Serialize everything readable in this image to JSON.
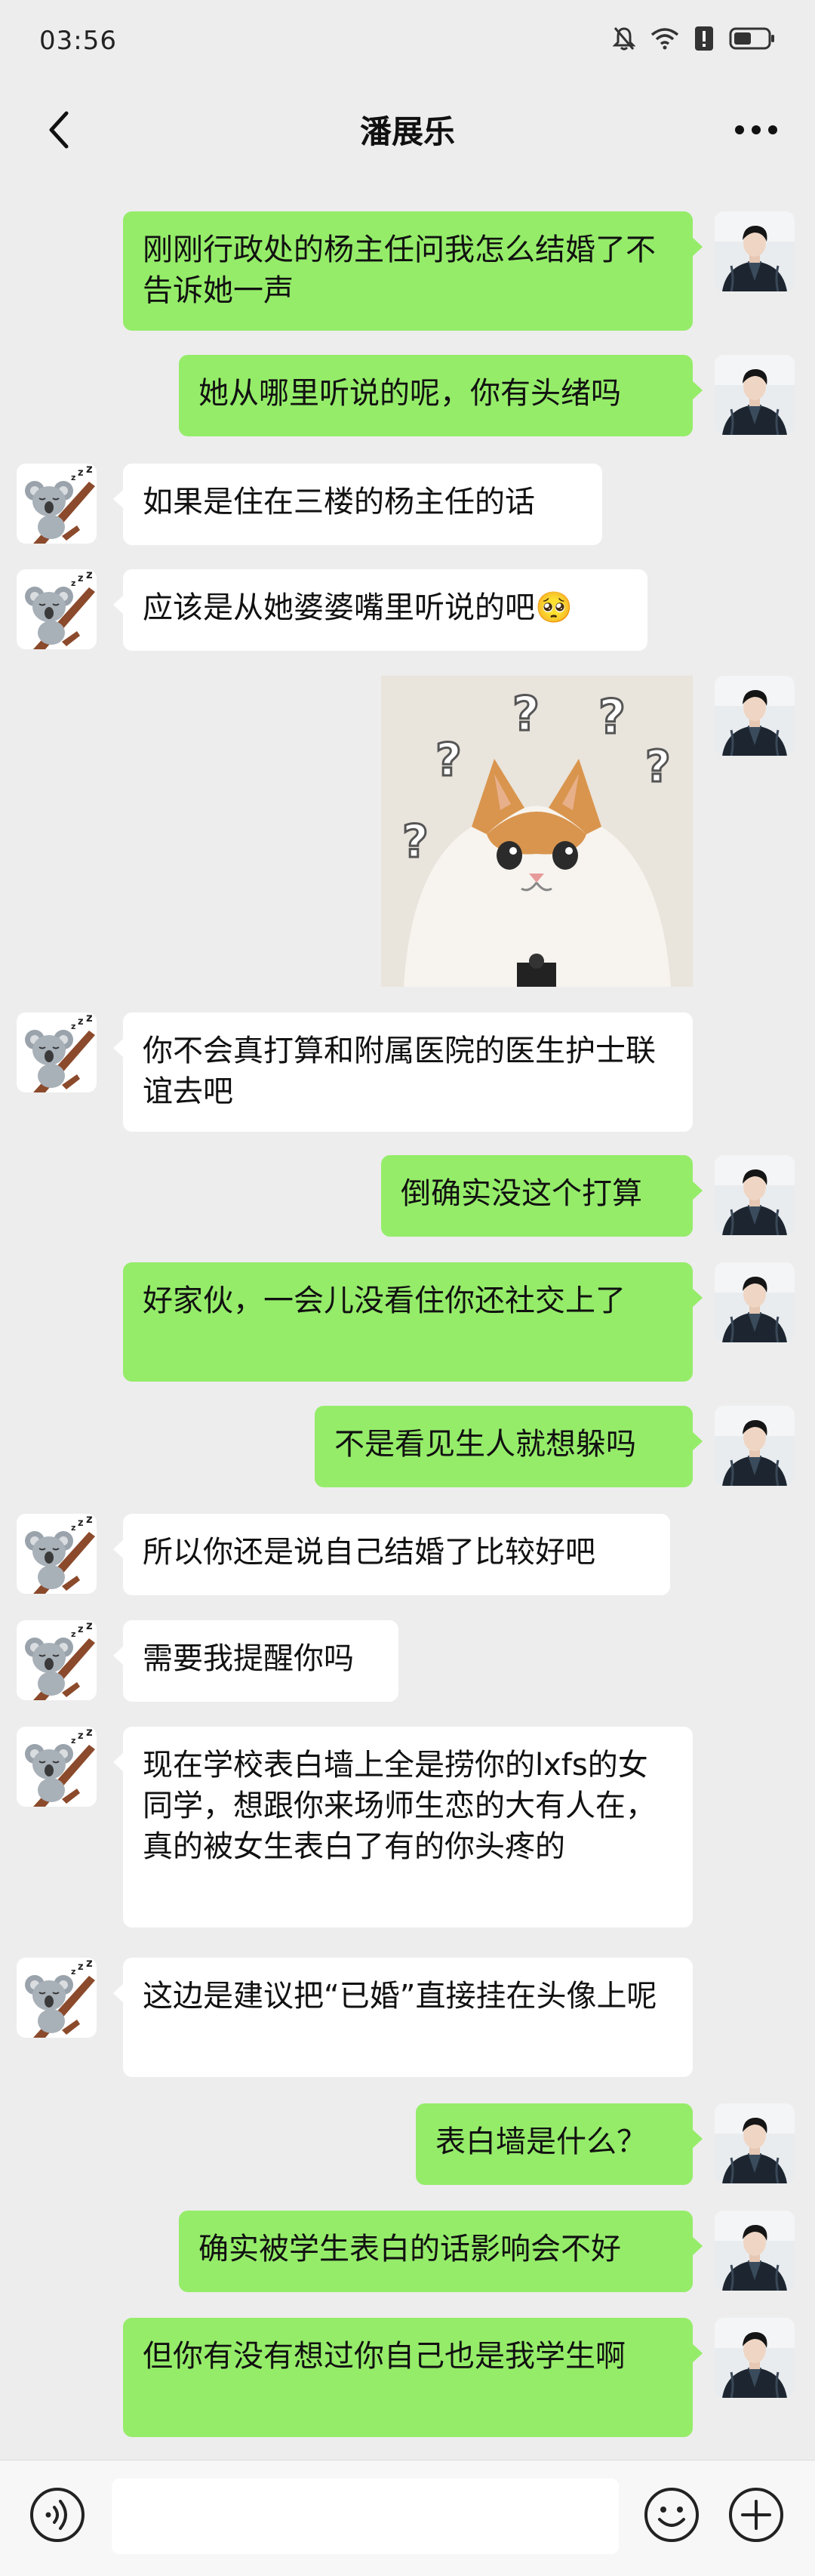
{
  "status_bar": {
    "time": "03:56"
  },
  "nav": {
    "title": "潘展乐"
  },
  "input": {
    "placeholder": ""
  },
  "messages": [
    {
      "side": "me",
      "type": "text",
      "text": "刚刚行政处的杨主任问我怎么结婚了不告诉她一声"
    },
    {
      "side": "me",
      "type": "text",
      "text": "她从哪里听说的呢，你有头绪吗"
    },
    {
      "side": "them",
      "type": "text",
      "text": "如果是住在三楼的杨主任的话"
    },
    {
      "side": "them",
      "type": "text",
      "text": "应该是从她婆婆嘴里听说的吧🥺"
    },
    {
      "side": "me",
      "type": "sticker",
      "sticker": "confused-cat-sticker"
    },
    {
      "side": "them",
      "type": "text",
      "text": "你不会真打算和附属医院的医生护士联谊去吧"
    },
    {
      "side": "me",
      "type": "text",
      "text": "倒确实没这个打算"
    },
    {
      "side": "me",
      "type": "text",
      "text": "好家伙，一会儿没看住你还社交上了"
    },
    {
      "side": "me",
      "type": "text",
      "text": "不是看见生人就想躲吗"
    },
    {
      "side": "them",
      "type": "text",
      "text": "所以你还是说自己结婚了比较好吧"
    },
    {
      "side": "them",
      "type": "text",
      "text": "需要我提醒你吗"
    },
    {
      "side": "them",
      "type": "text",
      "text": "现在学校表白墙上全是捞你的lxfs的女同学，想跟你来场师生恋的大有人在，真的被女生表白了有的你头疼的"
    },
    {
      "side": "them",
      "type": "text",
      "text": "这边是建议把“已婚”直接挂在头像上呢"
    },
    {
      "side": "me",
      "type": "text",
      "text": "表白墙是什么？"
    },
    {
      "side": "me",
      "type": "text",
      "text": "确实被学生表白的话影响会不好"
    },
    {
      "side": "me",
      "type": "text",
      "text": "但你有没有想过你自己也是我学生啊"
    }
  ],
  "icons": {
    "back": "back-arrow-icon",
    "more": "more-options-icon",
    "voice": "voice-input-icon",
    "emoji": "emoji-icon",
    "plus": "plus-icon",
    "my_avatar": "man-in-dark-coat-avatar",
    "their_avatar": "sleeping-koala-avatar"
  },
  "colors": {
    "background": "#ededed",
    "my_bubble": "#95ec69",
    "their_bubble": "#ffffff",
    "input_bar": "#f7f7f7"
  }
}
